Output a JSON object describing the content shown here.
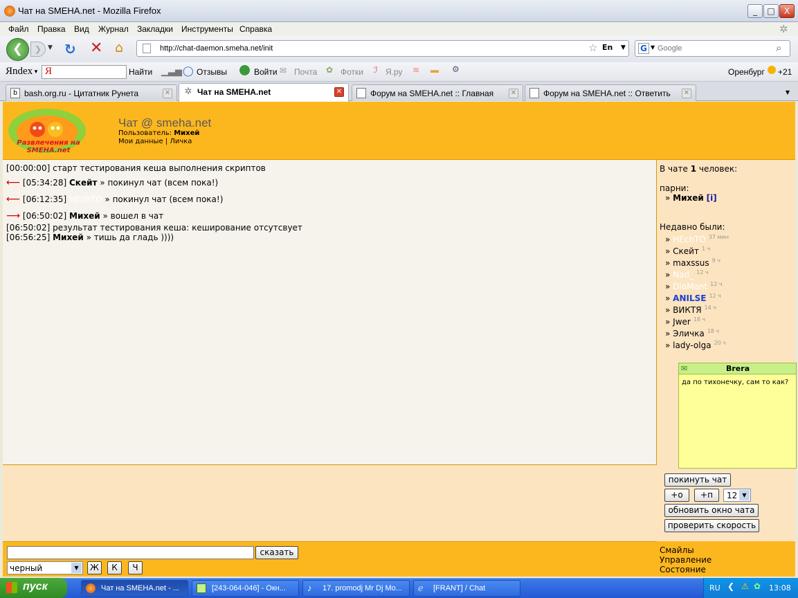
{
  "window": {
    "title": "Чат на SMEHA.net - Mozilla Firefox",
    "controls": [
      "_",
      "□",
      "X"
    ]
  },
  "menu": [
    "Файл",
    "Правка",
    "Вид",
    "Журнал",
    "Закладки",
    "Инструменты",
    "Справка"
  ],
  "nav": {
    "url": "http://chat-daemon.smeha.net/init",
    "lang": "En",
    "search_placeholder": "Google"
  },
  "yandex_bar": {
    "logo": "Яndex",
    "find": "Найти",
    "reviews": "Отзывы",
    "login": "Войти",
    "mail": "Почта",
    "photos": "Фотки",
    "yaru": "Я.ру",
    "city": "Оренбург",
    "temp": "+21"
  },
  "tabs": [
    {
      "label": "bash.org.ru - Цитатник Рунета",
      "icon": "b"
    },
    {
      "label": "Чат на SMEHA.net"
    },
    {
      "label": "Форум на SMEHA.net :: Главная"
    },
    {
      "label": "Форум на SMEHA.net :: Ответить"
    }
  ],
  "header": {
    "logo_text": "Развлечения на SMEHA.net",
    "title": "Чат @ smeha.net",
    "user_label": "Пользователь:",
    "user_name": "Михей",
    "link_mydata": "Мои данные",
    "link_sep": "|",
    "link_pm": "Личка"
  },
  "messages": [
    {
      "time": "[00:00:00]",
      "text": "старт тестирования кеша выполнения скриптов"
    },
    {
      "arrow": "⟵",
      "time": "[05:34:28]",
      "nick": "Скейт",
      "text": "» покинул чат (всем пока!)"
    },
    {
      "arrow": "⟵",
      "time": "[06:12:35]",
      "nick": "HEchTO",
      "text": "» покинул чат (всем пока!)"
    },
    {
      "arrow": "⟶",
      "time": "[06:50:02]",
      "nick": "Михей",
      "text": "» вошел в чат"
    },
    {
      "time": "[06:50:02]",
      "text": "результат тестирования кеша: кеширование отсутсвует"
    },
    {
      "time": "[06:56:25]",
      "nick": "Михей",
      "text": "» тишь да гладь ))))"
    }
  ],
  "sidebar": {
    "count_prefix": "В чате",
    "count": "1",
    "count_suffix": "человек:",
    "boys_label": "парни:",
    "online": [
      {
        "name": "Михей",
        "info": "[i]"
      }
    ],
    "recent_label": "Недавно были:",
    "recent": [
      {
        "name": "HEchTO",
        "ago": "37 мин"
      },
      {
        "name": "Скейт",
        "ago": "1 ч"
      },
      {
        "name": "maxssus",
        "ago": "9 ч"
      },
      {
        "name": "Nad_",
        "ago": "12 ч"
      },
      {
        "name": "DiaMant",
        "ago": "12 ч"
      },
      {
        "name": "ANILSE",
        "ago": "12 ч"
      },
      {
        "name": "ВИКТЯ",
        "ago": "14 ч"
      },
      {
        "name": "Jwer",
        "ago": "18 ч"
      },
      {
        "name": "Эличка",
        "ago": "18 ч"
      },
      {
        "name": "lady-olga",
        "ago": "20 ч"
      }
    ]
  },
  "popup": {
    "title": "Brera",
    "text": "да по тихонечку, сам то как?"
  },
  "controls": {
    "leave": "покинуть чат",
    "plus_o": "+о",
    "plus_p": "+п",
    "size": "12",
    "refresh": "обновить окно чата",
    "speed": "проверить скорость"
  },
  "input": {
    "say": "сказать",
    "color": "черный",
    "bold": "Ж",
    "italic": "К",
    "underline": "Ч"
  },
  "bottom_links": [
    "Смайлы",
    "Управление",
    "Состояние"
  ],
  "taskbar": {
    "start": "пуск",
    "tasks": [
      "Чат на SMEHA.net - ...",
      "[243-064-046] - Окн...",
      "17. promodj Mr Dj Mo...",
      "[FRANT] / Chat"
    ],
    "lang": "RU",
    "clock": "13:08"
  }
}
